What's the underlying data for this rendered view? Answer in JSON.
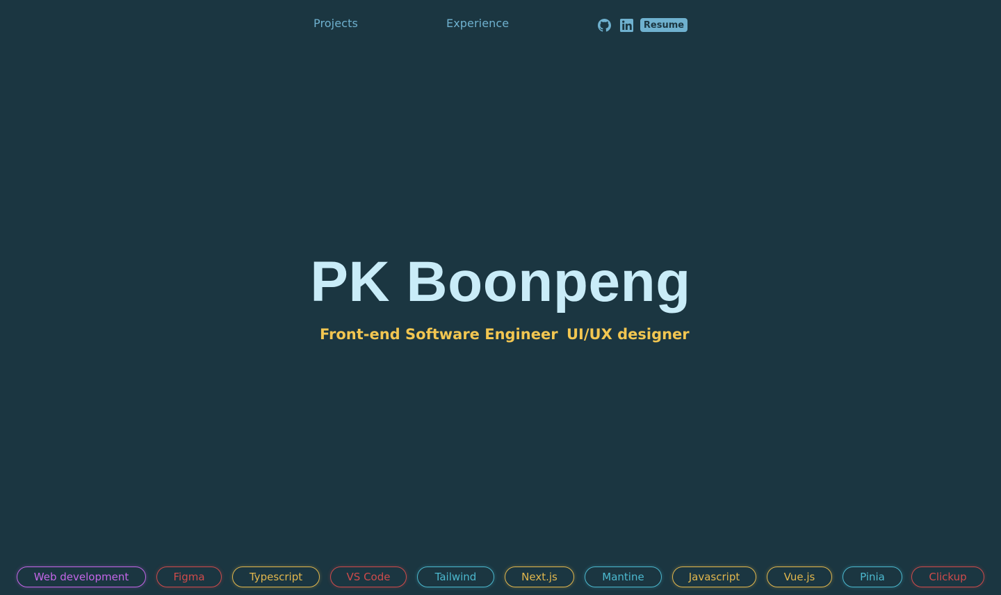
{
  "nav": {
    "projects_label": "Projects",
    "experience_label": "Experience",
    "github_icon": "github-icon",
    "linkedin_icon": "linkedin-icon",
    "resume_label": "Resume"
  },
  "hero": {
    "name": "PK Boonpeng",
    "roles": [
      "Front-end Software Engineer",
      "UI/UX designer"
    ]
  },
  "colors": {
    "background": "#1b3641",
    "accent_blue": "#6fb1cf",
    "title": "#c9ecf8",
    "subtitle": "#f2c651",
    "tag_purple": "#c466e8",
    "tag_red": "#cf4b4b",
    "tag_yellow": "#e2b74d",
    "tag_cyan": "#4cb9cf"
  },
  "tags": [
    {
      "label": "Web development",
      "color": "#c466e8"
    },
    {
      "label": "Figma",
      "color": "#cf4b4b"
    },
    {
      "label": "Typescript",
      "color": "#e2b74d"
    },
    {
      "label": "VS Code",
      "color": "#cf4b4b"
    },
    {
      "label": "Tailwind",
      "color": "#4cb9cf"
    },
    {
      "label": "Next.js",
      "color": "#e2b74d"
    },
    {
      "label": "Mantine",
      "color": "#4cb9cf"
    },
    {
      "label": "Javascript",
      "color": "#e2b74d"
    },
    {
      "label": "Vue.js",
      "color": "#e2b74d"
    },
    {
      "label": "Pinia",
      "color": "#4cb9cf"
    },
    {
      "label": "Clickup",
      "color": "#cf4b4b"
    }
  ]
}
